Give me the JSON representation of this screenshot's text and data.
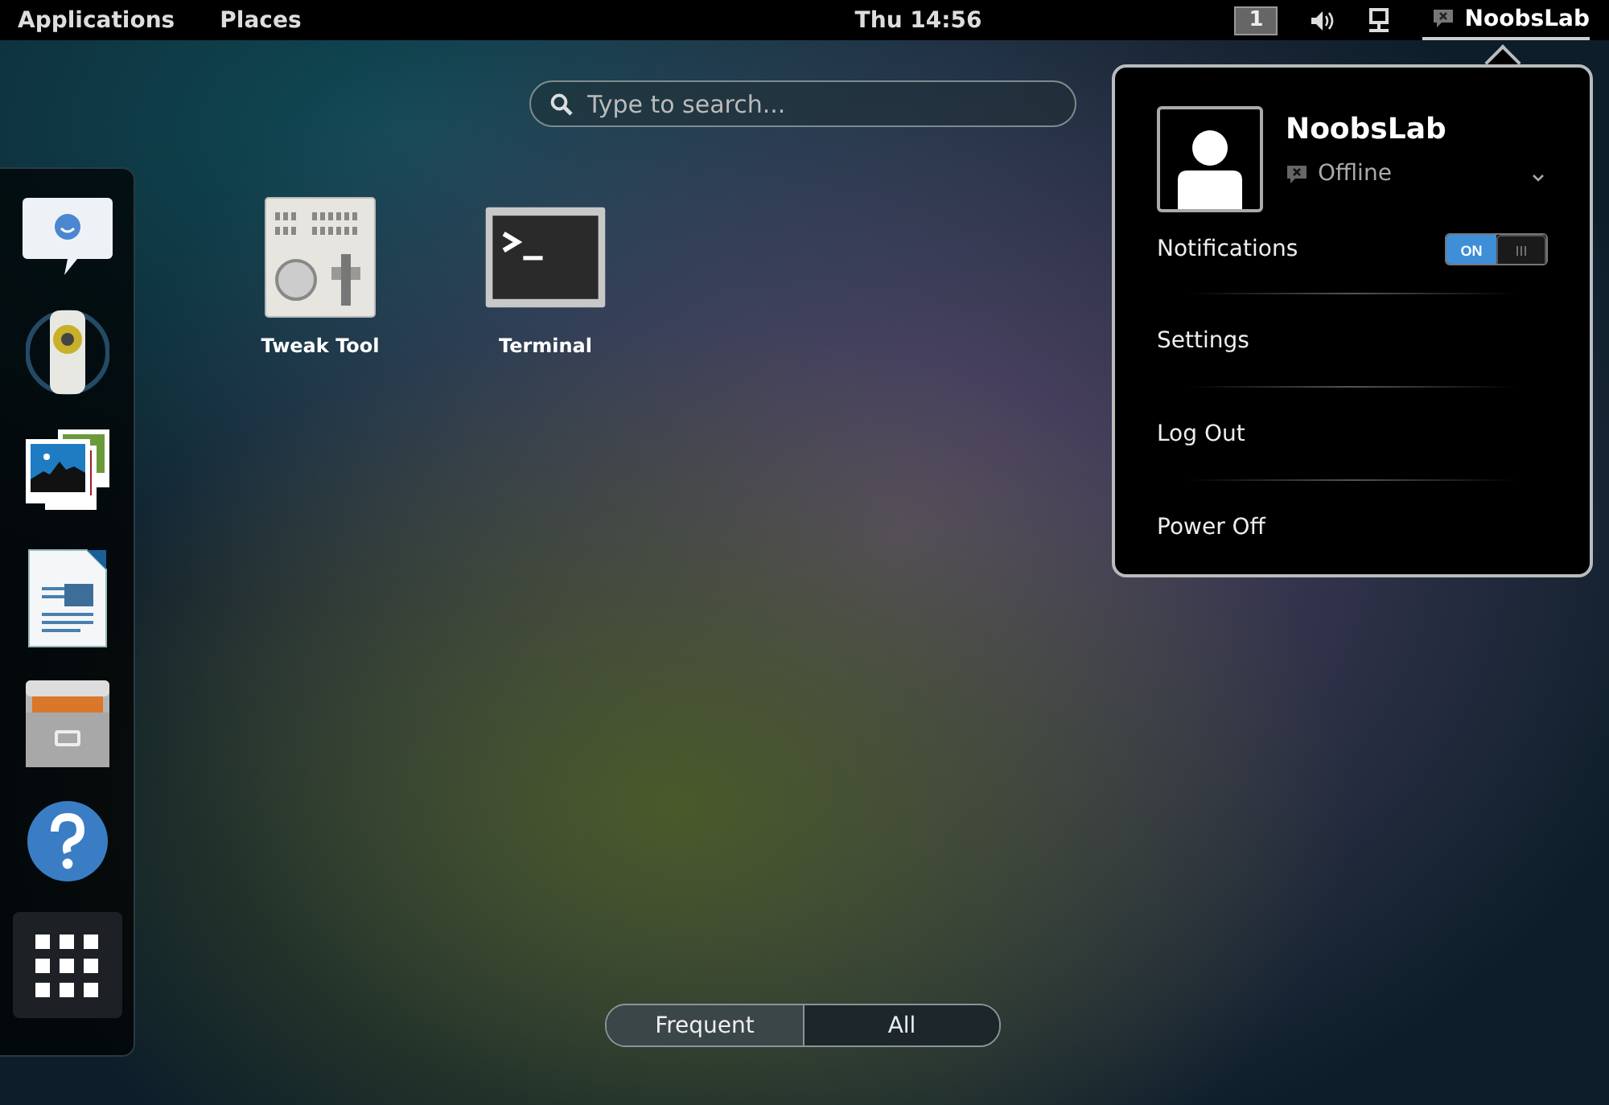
{
  "top_bar": {
    "menus": [
      "Applications",
      "Places"
    ],
    "clock": "Thu 14:56",
    "workspace": "1",
    "user": "NoobsLab"
  },
  "search": {
    "placeholder": "Type to search..."
  },
  "apps": [
    {
      "label": "Tweak Tool"
    },
    {
      "label": "Terminal"
    }
  ],
  "view_switcher": [
    {
      "label": "Frequent",
      "selected": false
    },
    {
      "label": "All",
      "selected": true
    }
  ],
  "user_menu": {
    "name": "NoobsLab",
    "status": "Offline",
    "notifications": {
      "label": "Notifications",
      "on": true,
      "on_label": "ON"
    },
    "items": [
      "Settings",
      "Log Out",
      "Power Off"
    ]
  }
}
